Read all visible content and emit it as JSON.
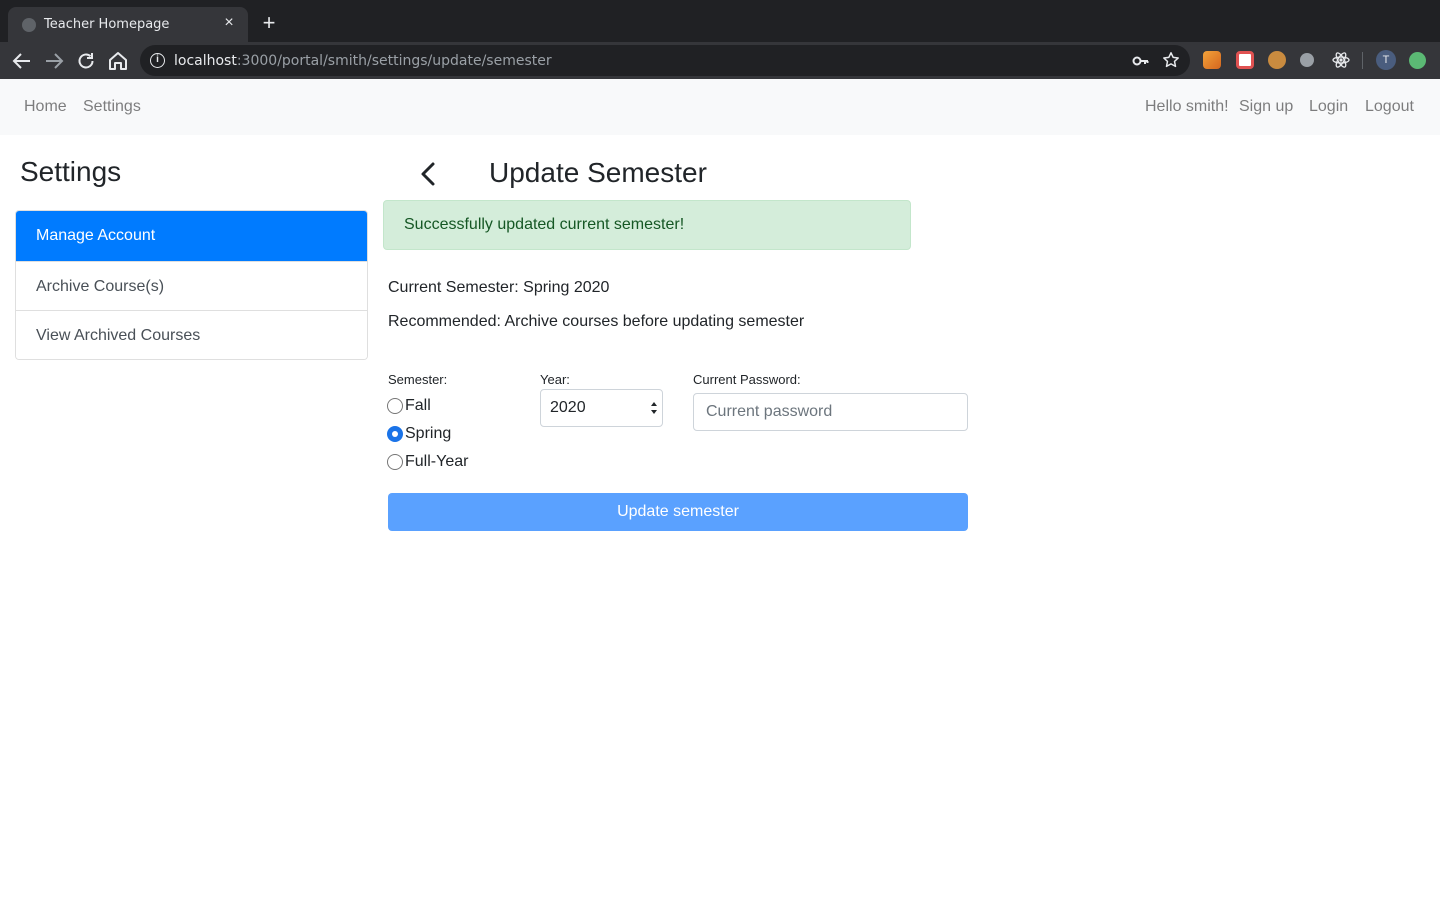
{
  "browser": {
    "tab_title": "Teacher Homepage",
    "tab_close": "×",
    "new_tab": "+",
    "url_host": "localhost",
    "url_rest": ":3000/portal/smith/settings/update/semester",
    "info_glyph": "i",
    "profile_initial": "T",
    "extension_colors": [
      "#f2a33a",
      "#e05252",
      "#c98b3f",
      "#9aa0a6",
      "#e8eaed"
    ]
  },
  "navbar": {
    "left_links": [
      "Home",
      "Settings"
    ],
    "greeting": "Hello smith!",
    "right_links": [
      "Sign up",
      "Login",
      "Logout"
    ]
  },
  "sidebar": {
    "title": "Settings",
    "items": [
      {
        "label": "Manage Account",
        "active": true
      },
      {
        "label": "Archive Course(s)",
        "active": false
      },
      {
        "label": "View Archived Courses",
        "active": false
      }
    ]
  },
  "main": {
    "title": "Update Semester",
    "alert": "Successfully updated current semester!",
    "current_semester": "Current Semester: Spring 2020",
    "recommendation": "Recommended: Archive courses before updating semester",
    "form": {
      "semester_label": "Semester:",
      "semester_options": [
        {
          "label": "Fall",
          "checked": false
        },
        {
          "label": "Spring",
          "checked": true
        },
        {
          "label": "Full-Year",
          "checked": false
        }
      ],
      "year_label": "Year:",
      "year_value": "2020",
      "password_label": "Current Password:",
      "password_placeholder": "Current password",
      "submit_label": "Update semester"
    }
  },
  "colors": {
    "primary": "#007bff",
    "alert_bg": "#d4edda",
    "alert_text": "#155724",
    "button_disabled": "#5aa1ff"
  }
}
